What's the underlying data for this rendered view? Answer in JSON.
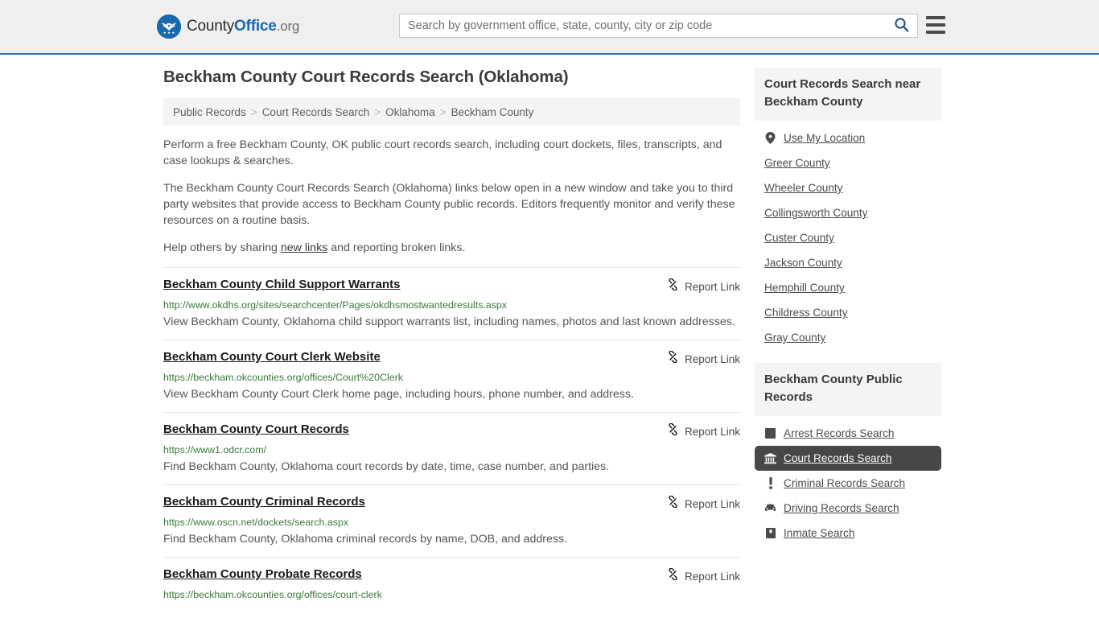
{
  "header": {
    "logo": {
      "part1": "County",
      "part2": "Office",
      "part3": ".org",
      "icon": "eagle-stars-seal-icon"
    },
    "search": {
      "placeholder": "Search by government office, state, county, city or zip code",
      "value": "",
      "search_icon": "search-icon"
    },
    "menu_icon": "hamburger-menu-icon",
    "accent_color": "#2a74a8"
  },
  "main": {
    "title": "Beckham County Court Records Search (Oklahoma)",
    "breadcrumb": [
      "Public Records",
      "Court Records Search",
      "Oklahoma",
      "Beckham County"
    ],
    "breadcrumb_separator": ">",
    "intro": {
      "p1": "Perform a free Beckham County, OK public court records search, including court dockets, files, transcripts, and case lookups & searches.",
      "p2": "The Beckham County Court Records Search (Oklahoma) links below open in a new window and take you to third party websites that provide access to Beckham County public records. Editors frequently monitor and verify these resources on a routine basis.",
      "p3_before": "Help others by sharing ",
      "p3_link": "new links",
      "p3_after": " and reporting broken links."
    },
    "report_label": "Report Link",
    "report_icon": "broken-link-icon",
    "results": [
      {
        "title": "Beckham County Child Support Warrants",
        "url": "http://www.okdhs.org/sites/searchcenter/Pages/okdhsmostwantedresults.aspx",
        "description": "View Beckham County, Oklahoma child support warrants list, including names, photos and last known addresses."
      },
      {
        "title": "Beckham County Court Clerk Website",
        "url": "https://beckham.okcounties.org/offices/Court%20Clerk",
        "description": "View Beckham County Court Clerk home page, including hours, phone number, and address."
      },
      {
        "title": "Beckham County Court Records",
        "url": "https://www1.odcr.com/",
        "description": "Find Beckham County, Oklahoma court records by date, time, case number, and parties."
      },
      {
        "title": "Beckham County Criminal Records",
        "url": "https://www.oscn.net/dockets/search.aspx",
        "description": "Find Beckham County, Oklahoma criminal records by name, DOB, and address."
      },
      {
        "title": "Beckham County Probate Records",
        "url": "https://beckham.okcounties.org/offices/court-clerk",
        "description": ""
      }
    ]
  },
  "sidebar": {
    "nearby": {
      "heading": "Court Records Search near Beckham County",
      "items": [
        {
          "label": "Use My Location",
          "icon": "map-pin-icon",
          "has_icon": true
        },
        {
          "label": "Greer County",
          "icon": "",
          "has_icon": false
        },
        {
          "label": "Wheeler County",
          "icon": "",
          "has_icon": false
        },
        {
          "label": "Collingsworth County",
          "icon": "",
          "has_icon": false
        },
        {
          "label": "Custer County",
          "icon": "",
          "has_icon": false
        },
        {
          "label": "Jackson County",
          "icon": "",
          "has_icon": false
        },
        {
          "label": "Hemphill County",
          "icon": "",
          "has_icon": false
        },
        {
          "label": "Childress County",
          "icon": "",
          "has_icon": false
        },
        {
          "label": "Gray County",
          "icon": "",
          "has_icon": false
        }
      ]
    },
    "public_records": {
      "heading": "Beckham County Public Records",
      "active_index": 1,
      "items": [
        {
          "label": "Arrest Records Search",
          "icon": "fingerprint-square-icon"
        },
        {
          "label": "Court Records Search",
          "icon": "courthouse-icon"
        },
        {
          "label": "Criminal Records Search",
          "icon": "exclamation-icon"
        },
        {
          "label": "Driving Records Search",
          "icon": "car-icon"
        },
        {
          "label": "Inmate Search",
          "icon": "inmate-icon"
        }
      ]
    }
  }
}
